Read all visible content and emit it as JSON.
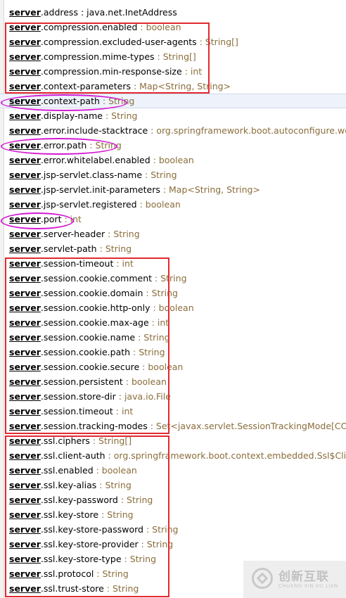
{
  "prefix": "server",
  "items": [
    {
      "prop": ".address",
      "type": "java.net.InetAddress"
    },
    {
      "prop": ".compression.enabled",
      "type": "boolean"
    },
    {
      "prop": ".compression.excluded-user-agents",
      "type": "String[]"
    },
    {
      "prop": ".compression.mime-types",
      "type": "String[]"
    },
    {
      "prop": ".compression.min-response-size",
      "type": "int"
    },
    {
      "prop": ".context-parameters",
      "type": "Map<String, String>"
    },
    {
      "prop": ".context-path",
      "type": "String"
    },
    {
      "prop": ".display-name",
      "type": "String"
    },
    {
      "prop": ".error.include-stacktrace",
      "type": "org.springframework.boot.autoconfigure.web.ErrorProperties$IncludeStacktrace"
    },
    {
      "prop": ".error.path",
      "type": "String"
    },
    {
      "prop": ".error.whitelabel.enabled",
      "type": "boolean"
    },
    {
      "prop": ".jsp-servlet.class-name",
      "type": "String"
    },
    {
      "prop": ".jsp-servlet.init-parameters",
      "type": "Map<String, String>"
    },
    {
      "prop": ".jsp-servlet.registered",
      "type": "boolean"
    },
    {
      "prop": ".port",
      "type": "int"
    },
    {
      "prop": ".server-header",
      "type": "String"
    },
    {
      "prop": ".servlet-path",
      "type": "String"
    },
    {
      "prop": ".session-timeout",
      "type": "int"
    },
    {
      "prop": ".session.cookie.comment",
      "type": "String"
    },
    {
      "prop": ".session.cookie.domain",
      "type": "String"
    },
    {
      "prop": ".session.cookie.http-only",
      "type": "boolean"
    },
    {
      "prop": ".session.cookie.max-age",
      "type": "int"
    },
    {
      "prop": ".session.cookie.name",
      "type": "String"
    },
    {
      "prop": ".session.cookie.path",
      "type": "String"
    },
    {
      "prop": ".session.cookie.secure",
      "type": "boolean"
    },
    {
      "prop": ".session.persistent",
      "type": "boolean"
    },
    {
      "prop": ".session.store-dir",
      "type": "java.io.File"
    },
    {
      "prop": ".session.timeout",
      "type": "int"
    },
    {
      "prop": ".session.tracking-modes",
      "type": "Set<javax.servlet.SessionTrackingMode[COOKIE, URL, SSL]>"
    },
    {
      "prop": ".ssl.ciphers",
      "type": "String[]"
    },
    {
      "prop": ".ssl.client-auth",
      "type": "org.springframework.boot.context.embedded.Ssl$ClientAuth"
    },
    {
      "prop": ".ssl.enabled",
      "type": "boolean"
    },
    {
      "prop": ".ssl.key-alias",
      "type": "String"
    },
    {
      "prop": ".ssl.key-password",
      "type": "String"
    },
    {
      "prop": ".ssl.key-store",
      "type": "String"
    },
    {
      "prop": ".ssl.key-store-password",
      "type": "String"
    },
    {
      "prop": ".ssl.key-store-provider",
      "type": "String"
    },
    {
      "prop": ".ssl.key-store-type",
      "type": "String"
    },
    {
      "prop": ".ssl.protocol",
      "type": "String"
    },
    {
      "prop": ".ssl.trust-store",
      "type": "String"
    }
  ],
  "separator": " : ",
  "colors": {
    "highlight_rect": "#e2292f",
    "highlight_oval": "#d419d4",
    "type_text": "#8a6d3b"
  },
  "watermark": {
    "name": "创新互联",
    "sub": "CHUANG XIN HU LIAN"
  }
}
